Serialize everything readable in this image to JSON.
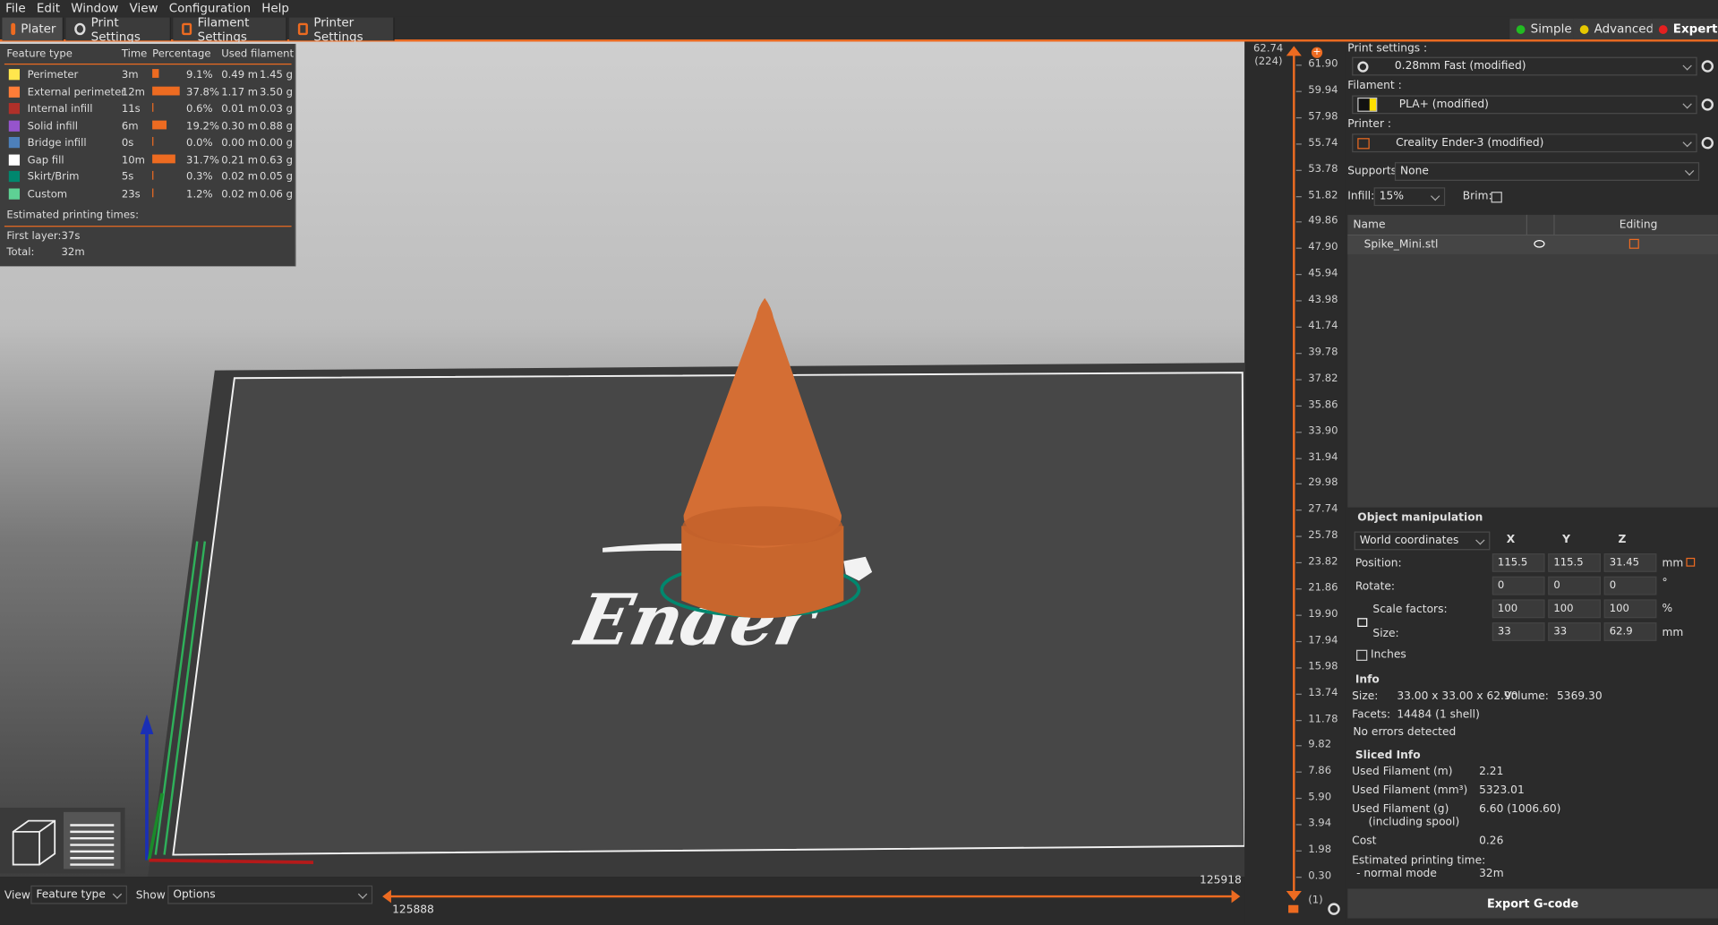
{
  "menu": [
    "File",
    "Edit",
    "Window",
    "View",
    "Configuration",
    "Help"
  ],
  "tabs": [
    {
      "label": "Plater",
      "icon": "plater-icon"
    },
    {
      "label": "Print Settings",
      "icon": "gear-icon"
    },
    {
      "label": "Filament Settings",
      "icon": "spool-icon"
    },
    {
      "label": "Printer Settings",
      "icon": "printer-icon"
    }
  ],
  "modes": [
    {
      "label": "Simple",
      "color": "#22bb22"
    },
    {
      "label": "Advanced",
      "color": "#e6c800"
    },
    {
      "label": "Expert",
      "color": "#e52020"
    }
  ],
  "legend": {
    "headers": [
      "Feature type",
      "Time",
      "Percentage",
      "Used filament"
    ],
    "rows": [
      {
        "name": "Perimeter",
        "color": "#ffe64d",
        "time": "3m",
        "percent": "9.1%",
        "pct": 9.1,
        "length": "0.49 m",
        "weight": "1.45 g"
      },
      {
        "name": "External perimeter",
        "color": "#ff7d38",
        "time": "12m",
        "percent": "37.8%",
        "pct": 37.8,
        "length": "1.17 m",
        "weight": "3.50 g"
      },
      {
        "name": "Internal infill",
        "color": "#b03029",
        "time": "11s",
        "percent": "0.6%",
        "pct": 0.6,
        "length": "0.01 m",
        "weight": "0.03 g"
      },
      {
        "name": "Solid infill",
        "color": "#9654cc",
        "time": "6m",
        "percent": "19.2%",
        "pct": 19.2,
        "length": "0.30 m",
        "weight": "0.88 g"
      },
      {
        "name": "Bridge infill",
        "color": "#4d80ba",
        "time": "0s",
        "percent": "0.0%",
        "pct": 0.0,
        "length": "0.00 m",
        "weight": "0.00 g"
      },
      {
        "name": "Gap fill",
        "color": "#ffffff",
        "time": "10m",
        "percent": "31.7%",
        "pct": 31.7,
        "length": "0.21 m",
        "weight": "0.63 g"
      },
      {
        "name": "Skirt/Brim",
        "color": "#00876e",
        "time": "5s",
        "percent": "0.3%",
        "pct": 0.3,
        "length": "0.02 m",
        "weight": "0.05 g"
      },
      {
        "name": "Custom",
        "color": "#5ed194",
        "time": "23s",
        "percent": "1.2%",
        "pct": 1.2,
        "length": "0.02 m",
        "weight": "0.06 g"
      }
    ],
    "est_label": "Estimated printing times:",
    "first_layer_label": "First layer:",
    "first_layer_value": "37s",
    "total_label": "Total:",
    "total_value": "32m"
  },
  "bed_logo_text": "Ender",
  "layer_slider": {
    "top_value": "62.74",
    "top_layer": "(224)",
    "ticks": [
      "61.90",
      "59.94",
      "57.98",
      "55.74",
      "53.78",
      "51.82",
      "49.86",
      "47.90",
      "45.94",
      "43.98",
      "41.74",
      "39.78",
      "37.82",
      "35.86",
      "33.90",
      "31.94",
      "29.98",
      "27.74",
      "25.78",
      "23.82",
      "21.86",
      "19.90",
      "17.94",
      "15.98",
      "13.74",
      "11.78",
      "9.82",
      "7.86",
      "5.90",
      "3.94",
      "1.98",
      "0.30"
    ],
    "bottom_layer": "(1)"
  },
  "right": {
    "print_settings_label": "Print settings :",
    "print_settings_value": "0.28mm Fast (modified)",
    "filament_label": "Filament :",
    "filament_value": "PLA+ (modified)",
    "printer_label": "Printer :",
    "printer_value": "Creality Ender-3    (modified)",
    "supports_label": "Supports:",
    "supports_value": "None",
    "infill_label": "Infill:",
    "infill_value": "15%",
    "brim_label": "Brim:",
    "list_name_header": "Name",
    "list_editing_header": "Editing",
    "object_name": "Spike_Mini.stl",
    "om_title": "Object manipulation",
    "coord_system": "World coordinates",
    "axes": [
      "X",
      "Y",
      "Z"
    ],
    "position_label": "Position:",
    "position": [
      "115.5",
      "115.5",
      "31.45"
    ],
    "position_unit": "mm",
    "rotate_label": "Rotate:",
    "rotate": [
      "0",
      "0",
      "0"
    ],
    "rotate_unit": "°",
    "scale_label": "Scale factors:",
    "scale": [
      "100",
      "100",
      "100"
    ],
    "scale_unit": "%",
    "size_label": "Size:",
    "size": [
      "33",
      "33",
      "62.9"
    ],
    "size_unit": "mm",
    "inches_label": "Inches",
    "info_title": "Info",
    "info_size_label": "Size:",
    "info_size_value": "33.00 x 33.00 x 62.90",
    "info_volume_label": "Volume:",
    "info_volume_value": "5369.30",
    "info_facets_label": "Facets:",
    "info_facets_value": "14484 (1 shell)",
    "info_errors": "No errors detected",
    "sliced_title": "Sliced Info",
    "used_m_label": "Used Filament (m)",
    "used_m_value": "2.21",
    "used_mm3_label": "Used Filament (mm³)",
    "used_mm3_value": "5323.01",
    "used_g_label": "Used Filament (g)",
    "used_g_sub": "(including spool)",
    "used_g_value": "6.60 (1006.60)",
    "cost_label": "Cost",
    "cost_value": "0.26",
    "est_label": "Estimated printing time:",
    "est_mode": "- normal mode",
    "est_value": "32m",
    "export_label": "Export G-code"
  },
  "bottom": {
    "view_label": "View",
    "view_value": "Feature type",
    "show_label": "Show",
    "show_value": "Options",
    "h_start": "125888",
    "h_end": "125918"
  }
}
